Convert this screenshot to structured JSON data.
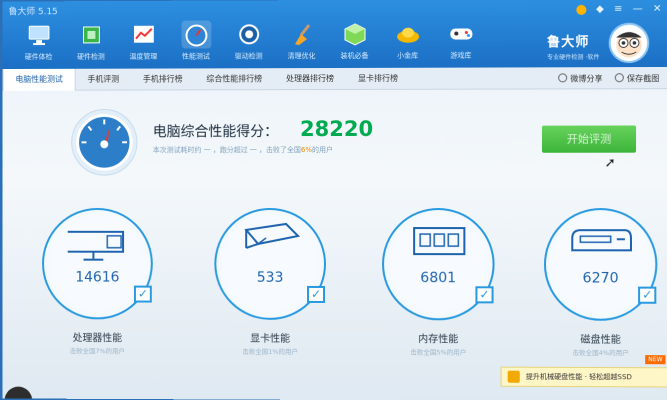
{
  "window": {
    "title": "鲁大师 5.15"
  },
  "nav": [
    {
      "label": "硬件体检",
      "icon": "monitor-icon"
    },
    {
      "label": "硬件检测",
      "icon": "chip-icon"
    },
    {
      "label": "温度管理",
      "icon": "temperature-chart-icon"
    },
    {
      "label": "性能测试",
      "icon": "speedometer-icon"
    },
    {
      "label": "驱动检测",
      "icon": "gear-driver-icon"
    },
    {
      "label": "清理优化",
      "icon": "broom-icon"
    },
    {
      "label": "装机必备",
      "icon": "cube-icon"
    },
    {
      "label": "小金库",
      "icon": "gold-ingot-icon"
    },
    {
      "label": "游戏库",
      "icon": "gamepad-icon"
    }
  ],
  "brand": {
    "name": "鲁大师",
    "sub": "专业硬件检测 ·软件"
  },
  "tabs": [
    "电脑性能测试",
    "手机评测",
    "手机排行榜",
    "综合性能排行榜",
    "处理器排行榜",
    "显卡排行榜"
  ],
  "tab_actions": {
    "share": "微博分享",
    "save": "保存截图"
  },
  "score": {
    "label": "电脑综合性能得分：",
    "value": "28220",
    "sub_prefix": "本次测试耗时约 一 ，跑分超过 一 ，",
    "sub_mid": "击败了全国",
    "sub_percent": "6%",
    "sub_suffix": "的用户"
  },
  "start_button": "开始评测",
  "cards": [
    {
      "name": "处理器性能",
      "value": "14616",
      "sub": "击败全国7%的用户",
      "icon": "cpu-monitor-icon"
    },
    {
      "name": "显卡性能",
      "value": "533",
      "sub": "击败全国1%的用户",
      "icon": "graphics-card-icon"
    },
    {
      "name": "内存性能",
      "value": "6801",
      "sub": "击败全国5%的用户",
      "icon": "memory-icon"
    },
    {
      "name": "磁盘性能",
      "value": "6270",
      "sub": "击败全国4%的用户",
      "icon": "disk-icon"
    }
  ],
  "promo": {
    "text": "提升机械硬盘性能 · 轻松超越SSD",
    "badge": "NEW"
  },
  "colors": {
    "header": "#1b6fc4",
    "score": "#00aa50",
    "button": "#3cb43a",
    "accent": "#2a9ae0"
  }
}
